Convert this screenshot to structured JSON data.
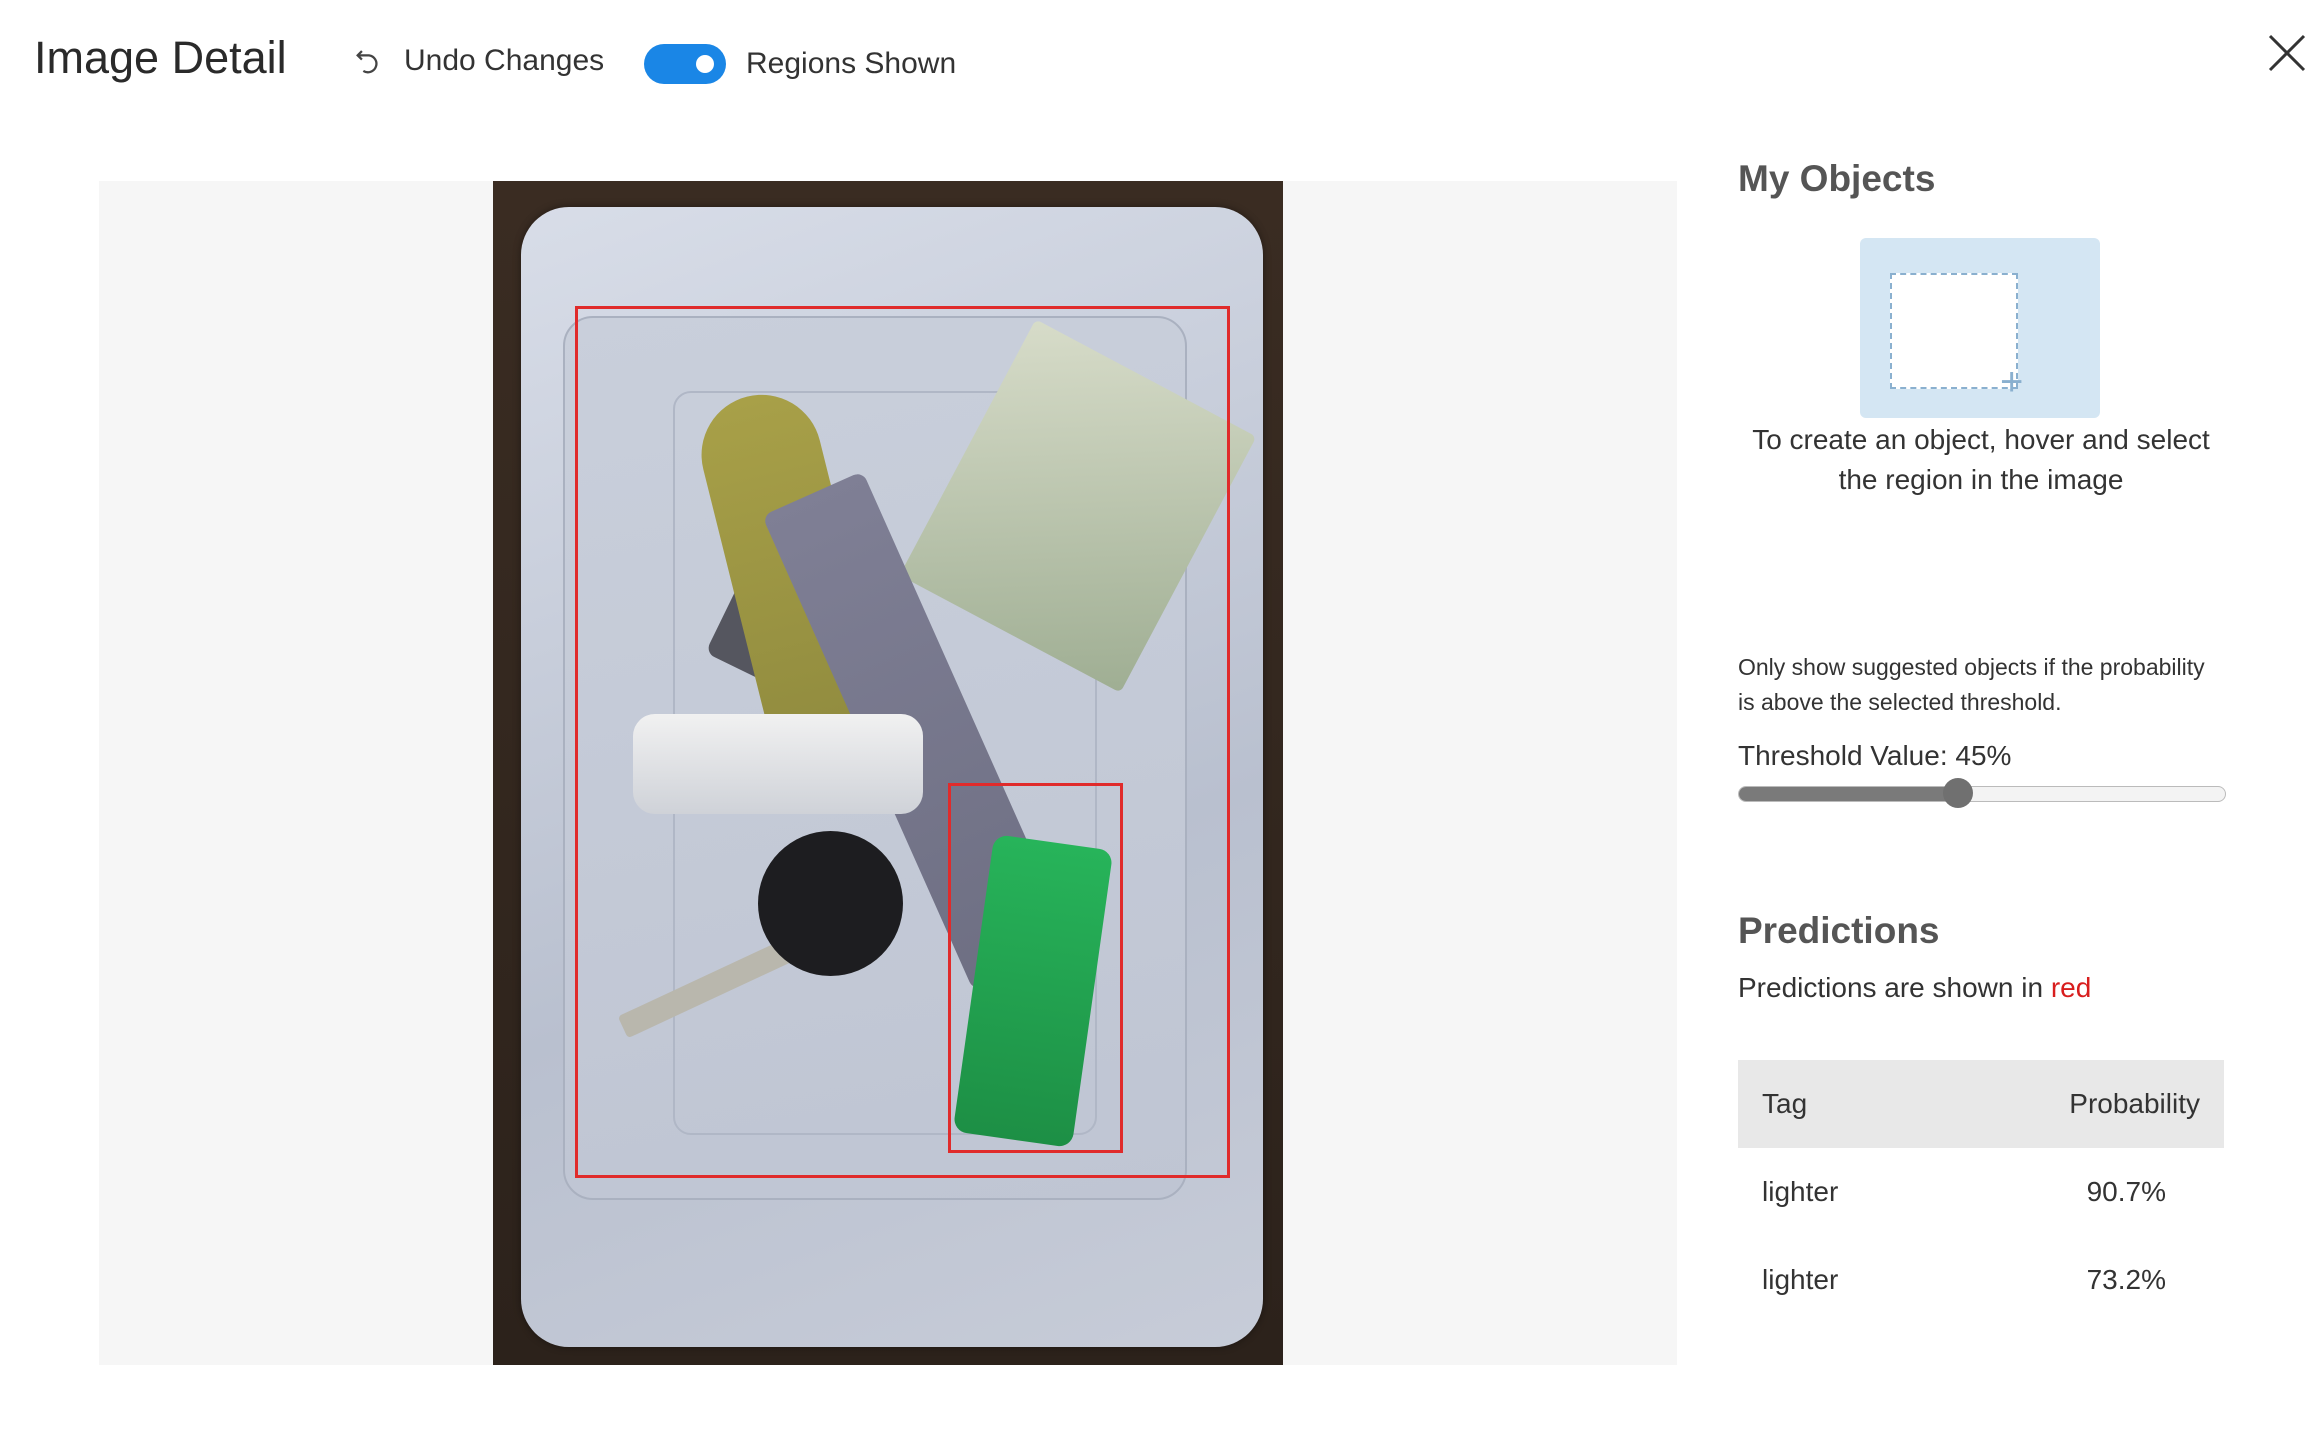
{
  "header": {
    "title": "Image Detail",
    "undo_label": "Undo Changes",
    "undo_icon": "undo-icon",
    "regions_toggle_label": "Regions Shown",
    "regions_toggle_on": true,
    "close_icon": "close-icon"
  },
  "panel": {
    "my_objects_title": "My Objects",
    "create_hint": "To create an object, hover and select the region in the image",
    "threshold_description": "Only show suggested objects if the probability is above the selected threshold.",
    "threshold_label": "Threshold Value: 45%",
    "threshold_value": 45,
    "predictions_title": "Predictions",
    "predictions_desc_prefix": "Predictions are shown in",
    "predictions_desc_color_word": "red",
    "table": {
      "headers": [
        "Tag",
        "Probability"
      ],
      "rows": [
        {
          "tag": "lighter",
          "probability": "90.7%"
        },
        {
          "tag": "lighter",
          "probability": "73.2%"
        }
      ]
    }
  },
  "colors": {
    "accent": "#1a86e6",
    "prediction": "#e02b2b"
  }
}
